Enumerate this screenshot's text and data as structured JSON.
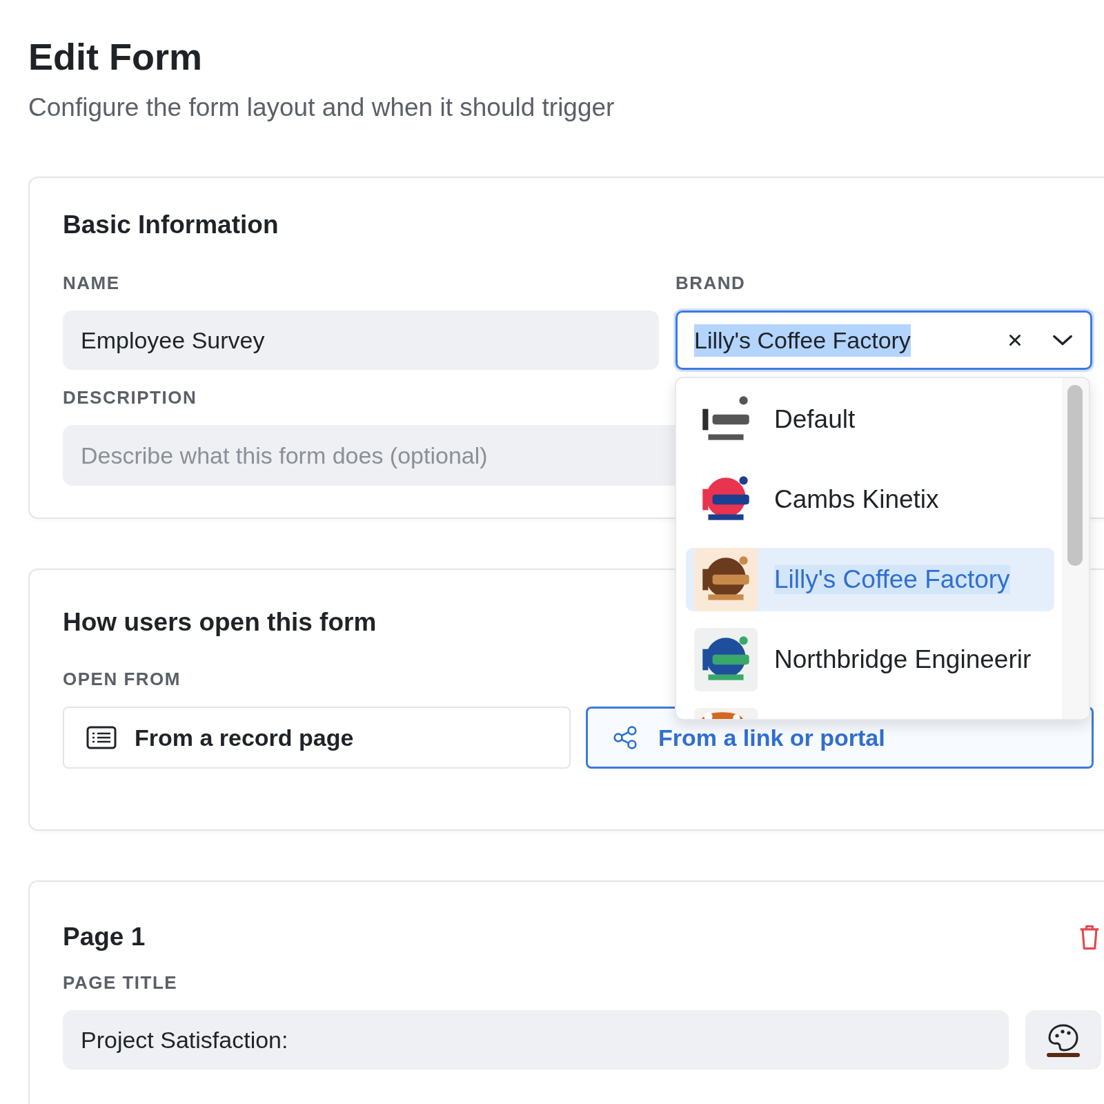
{
  "header": {
    "title": "Edit Form",
    "subtitle": "Configure the form layout and when it should trigger"
  },
  "basic": {
    "heading": "Basic Information",
    "name_label": "NAME",
    "name_value": "Employee Survey",
    "brand_label": "BRAND",
    "brand_value": "Lilly's Coffee Factory",
    "description_label": "DESCRIPTION",
    "description_placeholder": "Describe what this form does (optional)"
  },
  "brand_options": [
    {
      "label": "Default",
      "selected": false
    },
    {
      "label": "Cambs Kinetix",
      "selected": false
    },
    {
      "label": "Lilly's Coffee Factory",
      "selected": true
    },
    {
      "label": "Northbridge Engineerir",
      "selected": false
    }
  ],
  "open": {
    "heading": "How users open this form",
    "label": "OPEN FROM",
    "options": [
      {
        "kind": "record",
        "label": "From a record page",
        "selected": false
      },
      {
        "kind": "link",
        "label": "From a link or portal",
        "selected": true
      }
    ]
  },
  "page": {
    "heading": "Page 1",
    "title_label": "PAGE TITLE",
    "title_value": "Project Satisfaction:"
  }
}
